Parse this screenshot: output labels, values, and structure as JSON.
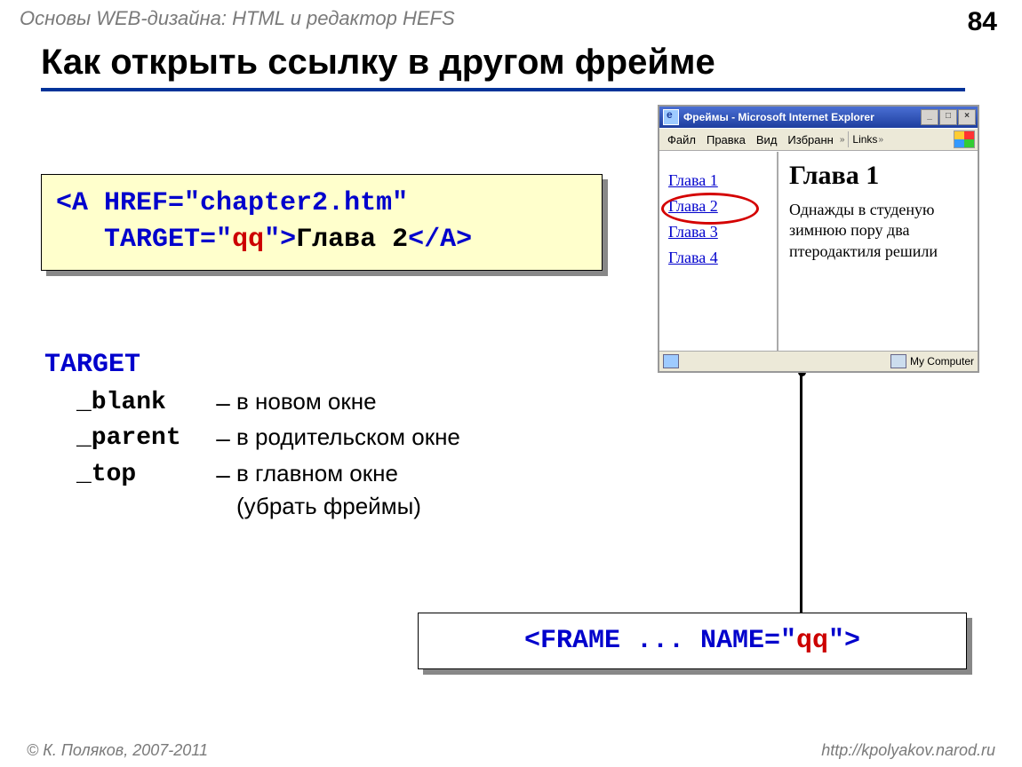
{
  "header": {
    "course_title": "Основы WEB-дизайна: HTML и редактор HEFS",
    "page_number": "84"
  },
  "title": "Как открыть ссылку в другом фрейме",
  "code_example": {
    "line1_open": "<A ",
    "href_attr": "HREF",
    "href_val": "=\"chapter2.htm\"",
    "line2_indent": "   ",
    "target_attr": "TARGET",
    "eq_quote": "=\"",
    "target_val": "qq",
    "close_quote_gt": "\">",
    "link_text": "Глава 2",
    "close_tag": "</A>"
  },
  "target_section": {
    "keyword": "TARGET",
    "rows": [
      {
        "name": "_blank",
        "desc": "в новом окне"
      },
      {
        "name": "_parent",
        "desc": "в родительском окне"
      },
      {
        "name": "_top",
        "desc": "в главном окне",
        "desc2": "(убрать фреймы)"
      }
    ]
  },
  "frame_code": {
    "open": "<FRAME ... ",
    "name_attr": "NAME",
    "eq_quote": "=\"",
    "val": "qq",
    "close": "\">"
  },
  "ie_window": {
    "title": "Фреймы - Microsoft Internet Explorer",
    "menu": [
      "Файл",
      "Правка",
      "Вид",
      "Избранн"
    ],
    "links_label": "Links",
    "chapters": [
      "Глава 1",
      "Глава 2",
      "Глава 3",
      "Глава 4"
    ],
    "content_heading": "Глава 1",
    "content_text": "Однажды в студеную зимнюю пору два птеродактиля решили",
    "status_right": "My Computer"
  },
  "footer": {
    "copyright": "© К. Поляков, 2007-2011",
    "url": "http://kpolyakov.narod.ru"
  }
}
